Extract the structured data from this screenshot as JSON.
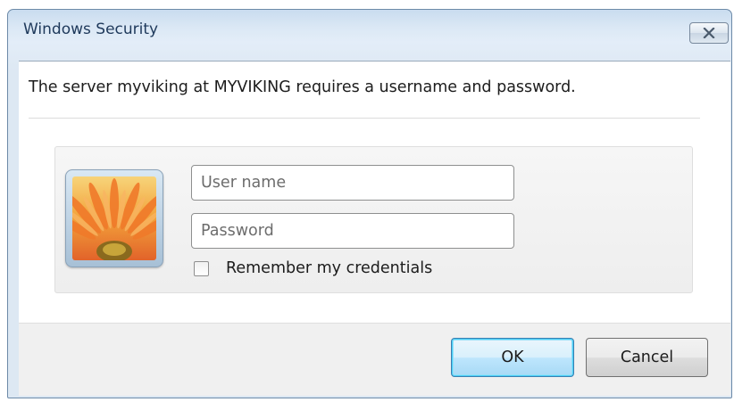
{
  "window": {
    "title": "Windows Security"
  },
  "dialog": {
    "message": "The server myviking at MYVIKING requires a username and password.",
    "fields": {
      "username_placeholder": "User name",
      "username_value": "",
      "password_placeholder": "Password",
      "password_value": ""
    },
    "remember": {
      "label": "Remember my credentials",
      "checked": false
    },
    "buttons": {
      "ok": "OK",
      "cancel": "Cancel"
    }
  },
  "icons": {
    "close": "close-icon",
    "avatar": "user-tile-flower-icon",
    "checkbox": "checkbox-icon"
  },
  "colors": {
    "title_text": "#1e395b",
    "frame": "#dbe8f5",
    "ok_button_accent": "#3c7fb1"
  }
}
